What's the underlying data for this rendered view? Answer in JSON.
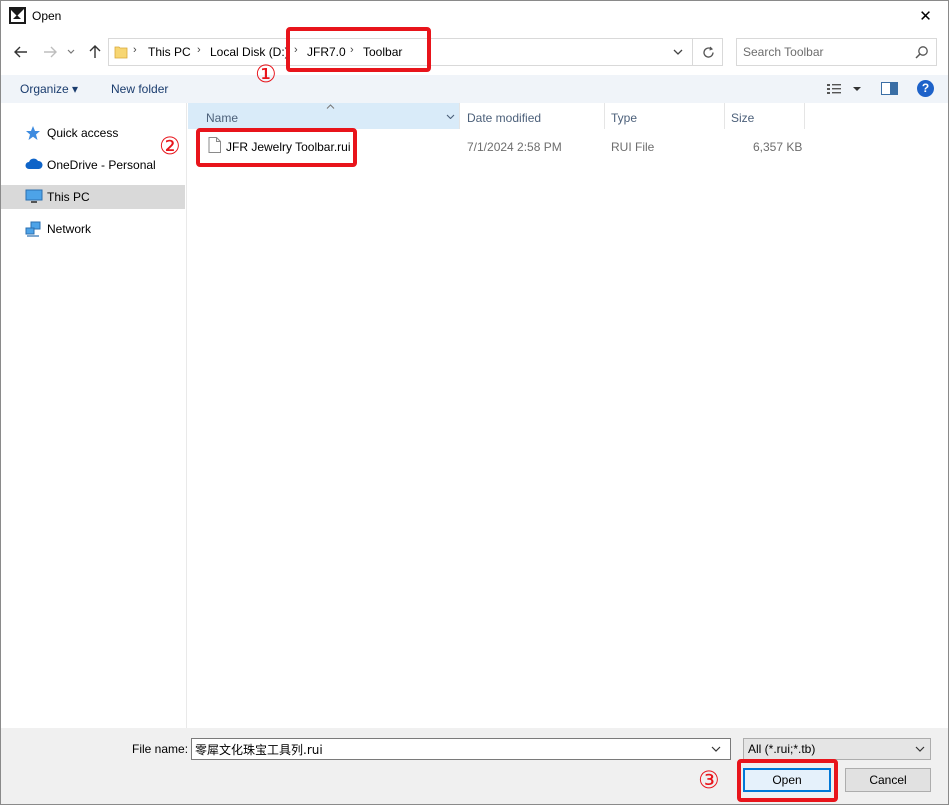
{
  "window": {
    "title": "Open",
    "close_glyph": "✕"
  },
  "icons": {
    "app": "app-logo-icon",
    "back": "arrow-left-icon",
    "forward": "arrow-right-icon",
    "recent": "chevron-down-icon",
    "up": "arrow-up-icon",
    "folder": "folder-icon",
    "refresh": "refresh-icon",
    "search": "search-icon",
    "view": "view-options-icon",
    "preview": "preview-pane-icon",
    "help": "help-icon",
    "file": "document-icon"
  },
  "address": {
    "crumbs": [
      "This PC",
      "Local Disk (D:)",
      "JFR7.0",
      "Toolbar"
    ],
    "separator": "›"
  },
  "search": {
    "placeholder": "Search Toolbar"
  },
  "toolbar": {
    "organize": "Organize ▾",
    "new_folder": "New folder",
    "help_glyph": "?"
  },
  "nav": {
    "items": [
      {
        "label": "Quick access"
      },
      {
        "label": "OneDrive - Personal"
      },
      {
        "label": "This PC",
        "selected": true
      },
      {
        "label": "Network"
      }
    ]
  },
  "columns": {
    "name": "Name",
    "date": "Date modified",
    "type": "Type",
    "size": "Size"
  },
  "files": [
    {
      "name": "JFR Jewelry Toolbar.rui",
      "date": "7/1/2024 2:58 PM",
      "type": "RUI File",
      "size": "6,357 KB"
    }
  ],
  "bottom": {
    "file_name_label": "File name:",
    "file_name_value": "零犀文化珠宝工具列.rui",
    "file_type": "All (*.rui;*.tb)",
    "open_label": "Open",
    "cancel_label": "Cancel"
  },
  "annotations": {
    "step1": "①",
    "step2": "②",
    "step3": "③"
  },
  "colors": {
    "accent": "#0078d7",
    "annotation": "#e8141b",
    "selected_nav": "#d9d9d9",
    "header_highlight": "#d9ebf9"
  }
}
